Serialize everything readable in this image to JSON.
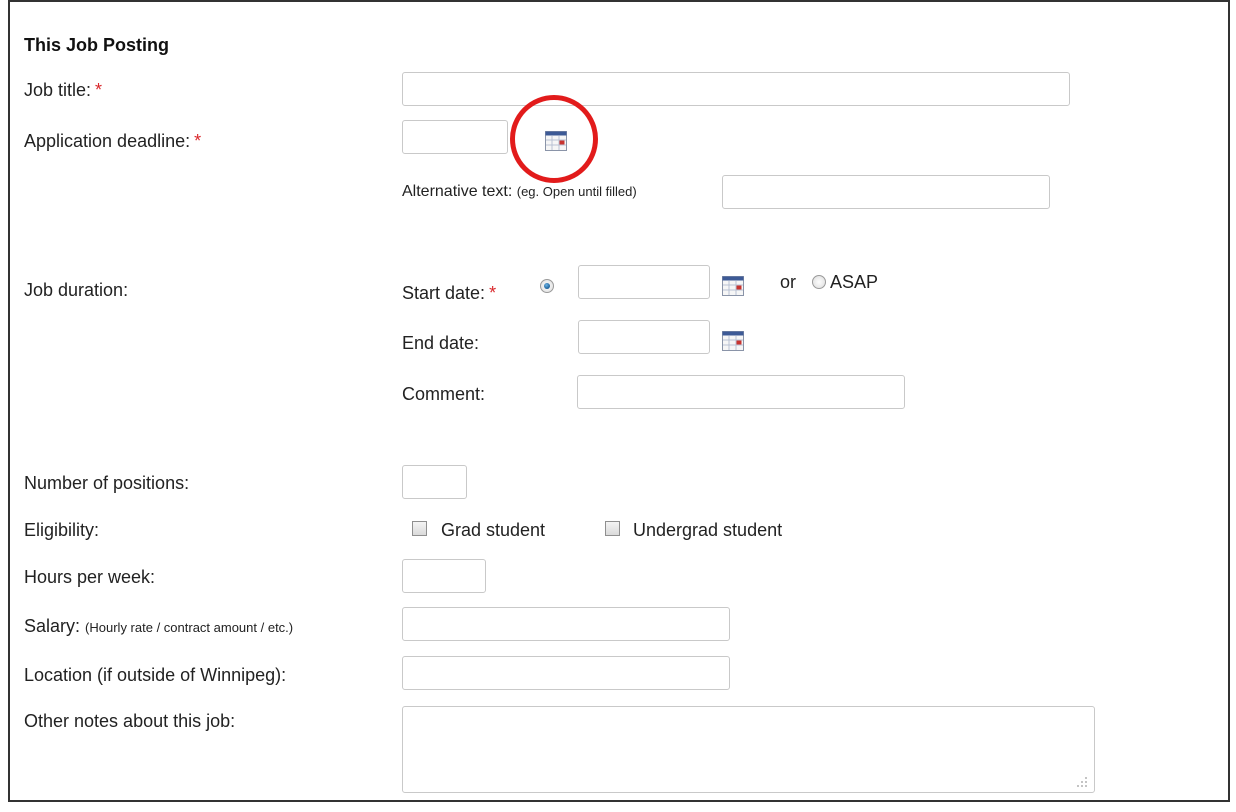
{
  "section": {
    "title": "This Job Posting"
  },
  "required_marker": "*",
  "fields": {
    "job_title": {
      "label": "Job title:",
      "value": ""
    },
    "application_deadline": {
      "label": "Application deadline:",
      "value": ""
    },
    "alternative_text": {
      "label": "Alternative text:",
      "hint": "(eg. Open until filled)",
      "value": ""
    },
    "job_duration": {
      "label": "Job duration:"
    },
    "start_date": {
      "label": "Start date:",
      "value": "",
      "radio_selected": true
    },
    "or_text": "or",
    "asap": {
      "label": "ASAP",
      "selected": false
    },
    "end_date": {
      "label": "End date:",
      "value": ""
    },
    "comment": {
      "label": "Comment:",
      "value": ""
    },
    "number_of_positions": {
      "label": "Number of positions:",
      "value": ""
    },
    "eligibility": {
      "label": "Eligibility:",
      "options": [
        {
          "label": "Grad student",
          "checked": false
        },
        {
          "label": "Undergrad student",
          "checked": false
        }
      ]
    },
    "hours_per_week": {
      "label": "Hours per week:",
      "value": ""
    },
    "salary": {
      "label": "Salary:",
      "hint": "(Hourly rate / contract amount / etc.)",
      "value": ""
    },
    "location": {
      "label": "Location (if outside of Winnipeg):",
      "value": ""
    },
    "other_notes": {
      "label": "Other notes about this job:",
      "value": ""
    }
  },
  "icons": {
    "calendar": "calendar-icon",
    "annotation": "red-circle-annotation"
  },
  "colors": {
    "required": "#d9262a",
    "annotation": "#e21b1b",
    "radio_selected": "#1a5f99"
  }
}
